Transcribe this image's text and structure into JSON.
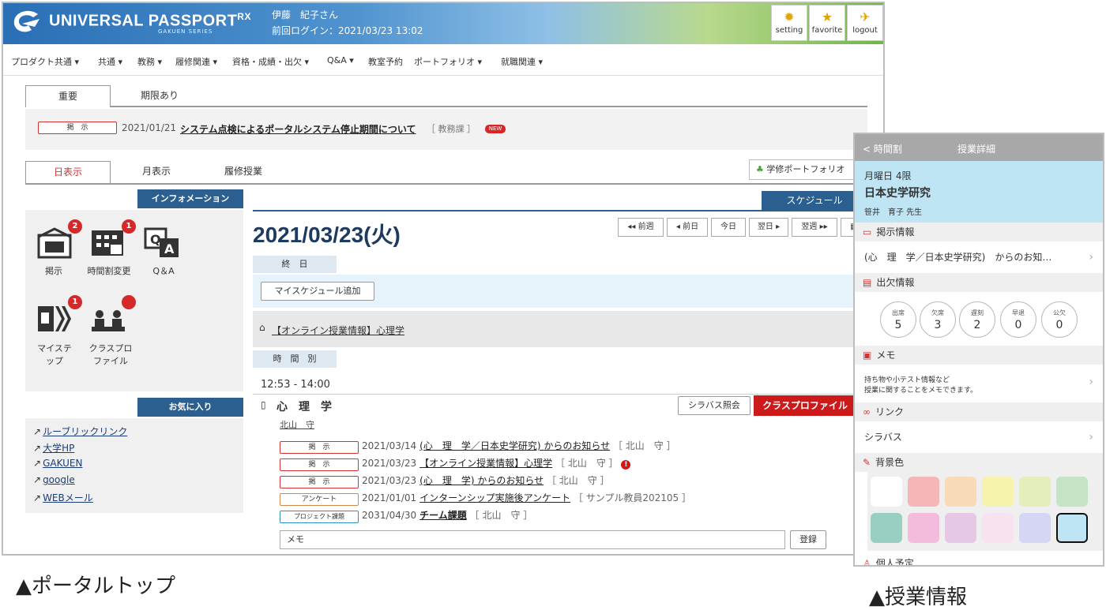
{
  "portal": {
    "header": {
      "brand": "UNIVERSAL PASSPORT",
      "brand_suffix": "RX",
      "series": "GAKUEN SERIES",
      "user_name": "伊藤　紀子さん",
      "last_login": "前回ログイン：2021/03/23 13:02",
      "buttons": [
        {
          "label": "setting",
          "icon": "gear-icon"
        },
        {
          "label": "favorite",
          "icon": "star-icon"
        },
        {
          "label": "logout",
          "icon": "runner-icon"
        }
      ]
    },
    "nav": [
      "プロダクト共通 ▾",
      "共通 ▾",
      "教務 ▾",
      "履修関連 ▾",
      "資格・成績・出欠 ▾",
      "Q&A ▾",
      "教室予約",
      "ポートフォリオ ▾",
      "就職関連 ▾"
    ],
    "notice_tabs": [
      "重要",
      "期限あり"
    ],
    "notice": {
      "badge": "掲　示",
      "date": "2021/01/21",
      "title": "システム点検によるポータルシステム停止期間について",
      "dept": "［ 教務課 ］",
      "new_tag": "NEW"
    },
    "view_tabs": [
      "日表示",
      "月表示",
      "履修授業"
    ],
    "portfolio_button": "学修ポートフォリオ",
    "info": {
      "title": "インフォメーション",
      "items": [
        {
          "label": "掲示",
          "count": "2",
          "icon": "bulletin-icon"
        },
        {
          "label": "時間割変更",
          "count": "1",
          "icon": "timetable-change-icon"
        },
        {
          "label": "Q＆A",
          "count": "",
          "icon": "qa-icon"
        },
        {
          "label": "マイステップ",
          "count": "1",
          "icon": "mystep-icon"
        },
        {
          "label": "クラスプロファイル",
          "count": "",
          "icon": "class-profile-icon"
        }
      ]
    },
    "favorites": {
      "title": "お気に入り",
      "links": [
        "ルーブリックリンク",
        "大学HP",
        "GAKUEN",
        "google",
        "WEBメール"
      ]
    },
    "schedule": {
      "title": "スケジュール",
      "date": "2021/03/23(火)",
      "nav_buttons": [
        "◂◂ 前週",
        "◂ 前日",
        "今日",
        "翌日 ▸",
        "翌週 ▸▸"
      ],
      "section_allday": "終　日",
      "add_button": "マイスケジュール追加",
      "online_link": "【オンライン授業情報】心理学",
      "section_period": "時　間　別",
      "time": "12:53 - 14:00",
      "course": "心　理　学",
      "teacher": "北山　守",
      "syllabus_button": "シラバス照会",
      "class_profile_button": "クラスプロファイル",
      "notices": [
        {
          "badge": "掲　示",
          "kind": "red",
          "date": "2021/03/14",
          "title": "(心　理　学／日本史学研究) からのお知らせ",
          "who": "［ 北山　守 ］",
          "alert": ""
        },
        {
          "badge": "掲　示",
          "kind": "red",
          "date": "2021/03/23",
          "title": "【オンライン授業情報】心理学",
          "who": "［ 北山　守 ］",
          "alert": "!"
        },
        {
          "badge": "掲　示",
          "kind": "red",
          "date": "2021/03/23",
          "title": "(心　理　学) からのお知らせ",
          "who": "［ 北山　守 ］",
          "alert": ""
        },
        {
          "badge": "アンケート",
          "kind": "orange",
          "date": "2021/01/01",
          "title": "インターンシップ実施後アンケート",
          "who": "［ サンプル教員202105 ］",
          "alert": ""
        },
        {
          "badge": "プロジェクト課題",
          "kind": "blue",
          "date": "2031/04/30",
          "title": "チーム課題",
          "who": "［ 北山　守 ］",
          "alert": ""
        }
      ],
      "memo_placeholder": "メモ",
      "register_button": "登録"
    },
    "caption": "▲ポータルトップ"
  },
  "mobile": {
    "back": "< 時間割",
    "title": "授業詳細",
    "period": "月曜日 4限",
    "course": "日本史学研究",
    "teacher": "笹井　育子 先生",
    "sections": {
      "notice": "掲示情報",
      "attendance": "出欠情報",
      "memo": "メモ",
      "link": "リンク",
      "bg": "背景色",
      "personal": "個人予定"
    },
    "notice_row": "(心　理　学／日本史学研究)　からのお知…",
    "attendance": [
      {
        "label": "出席",
        "value": "5"
      },
      {
        "label": "欠席",
        "value": "3"
      },
      {
        "label": "遅刻",
        "value": "2"
      },
      {
        "label": "早退",
        "value": "0"
      },
      {
        "label": "公欠",
        "value": "0"
      }
    ],
    "memo_line1": "持ち物や小テスト情報など",
    "memo_line2": "授業に関することをメモできます。",
    "link_row": "シラバス",
    "swatches": [
      "#ffffff",
      "#f4b6b6",
      "#f8d9b8",
      "#f6f3ad",
      "#e3eebb",
      "#c5e3c5",
      "#98cfc2",
      "#f3bcdc",
      "#e7c8e4",
      "#f6e3ef",
      "#d4d6f4",
      "#bfe4f4"
    ],
    "selected_swatch": "11",
    "caption": "▲授業情報"
  }
}
